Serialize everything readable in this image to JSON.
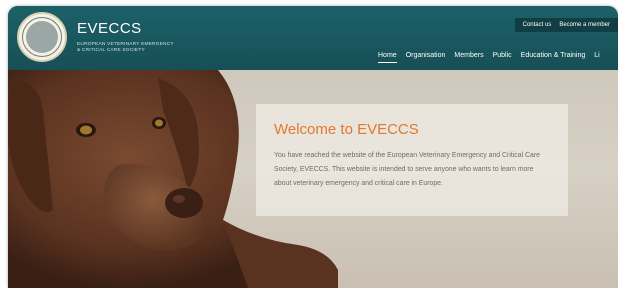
{
  "header": {
    "brand": "EVECCS",
    "subtitle_line1": "EUROPEAN VETERINARY EMERGENCY",
    "subtitle_line2": "& CRITICAL CARE SOCIETY",
    "top_links": [
      "Contact us",
      "Become a member"
    ],
    "nav": [
      "Home",
      "Organisation",
      "Members",
      "Public",
      "Education & Training",
      "Li"
    ]
  },
  "hero": {
    "title": "Welcome to EVECCS",
    "intro": "You have reached the website of the European Veterinary Emergency and Critical Care Society, EVECCS. This website is intended to serve anyone who wants to learn more about veterinary emergency and critical care in Europe."
  },
  "colors": {
    "header_bg": "#1c6168",
    "topbar_bg": "#103e44",
    "accent": "#e0782f"
  }
}
